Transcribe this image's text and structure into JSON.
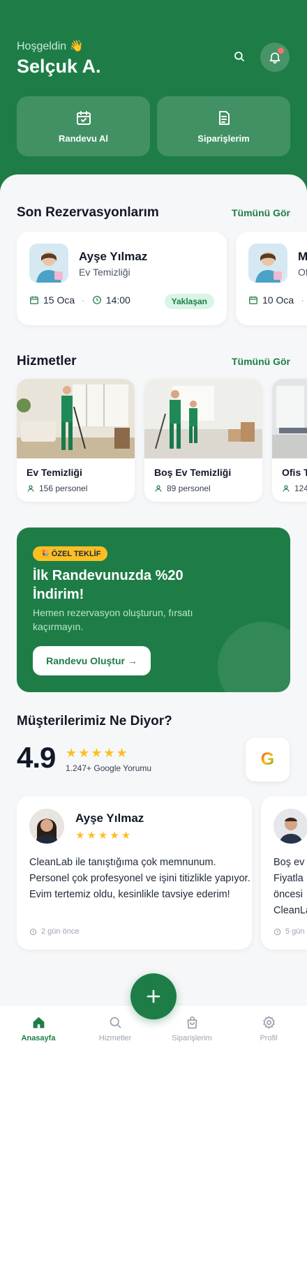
{
  "header": {
    "greeting": "Hoşgeldin 👋",
    "user_name": "Selçuk A.",
    "actions": [
      "search-icon",
      "bell-icon"
    ],
    "quick_actions": [
      {
        "label": "Randevu Al",
        "icon": "calendar-check-icon"
      },
      {
        "label": "Siparişlerim",
        "icon": "receipt-icon"
      }
    ]
  },
  "bookings": {
    "title": "Son Rezervasyonlarım",
    "see_all": "Tümünü Gör",
    "items": [
      {
        "name": "Ayşe Yılmaz",
        "service": "Ev Temizliği",
        "date": "15 Oca",
        "time": "14:00",
        "status": "Yaklaşan"
      },
      {
        "name": "M",
        "service": "Of",
        "date": "10 Oca",
        "time": "",
        "status": ""
      }
    ]
  },
  "services": {
    "title": "Hizmetler",
    "see_all": "Tümünü Gör",
    "items": [
      {
        "name": "Ev Temizliği",
        "count": "156 personel"
      },
      {
        "name": "Boş Ev Temizliği",
        "count": "89 personel"
      },
      {
        "name": "Ofis T",
        "count": "124"
      }
    ]
  },
  "promo": {
    "badge": "🎉 ÖZEL TEKLİF",
    "title": "İlk Randevunuzda %20 İndirim!",
    "subtitle": "Hemen rezervasyon oluşturun, fırsatı kaçırmayın.",
    "cta": "Randevu Oluştur →"
  },
  "reviews": {
    "title": "Müşterilerimiz Ne Diyor?",
    "rating": "4.9",
    "stars": "★★★★★",
    "count": "1.247+ Google Yorumu",
    "google_letter": "G",
    "items": [
      {
        "name": "Ayşe Yılmaz",
        "stars": "★★★★★",
        "text": "CleanLab ile tanıştığıma çok memnunum. Personel çok profesyonel ve işini titizlikle yapıyor. Evim tertemiz oldu, kesinlikle tavsiye ederim!",
        "time": "2 gün önce"
      },
      {
        "name": "",
        "stars": "",
        "text": "Boş ev Fiyatla öncesi CleanLa",
        "time": "5 gün"
      }
    ]
  },
  "nav": {
    "items": [
      {
        "label": "Anasayfa",
        "icon": "home-icon",
        "active": true
      },
      {
        "label": "Hizmetler",
        "icon": "search-icon",
        "active": false
      },
      {
        "label": "Siparişlerim",
        "icon": "shopping-bag-icon",
        "active": false
      },
      {
        "label": "Profil",
        "icon": "gear-icon",
        "active": false
      }
    ],
    "fab_icon": "plus-icon"
  },
  "colors": {
    "brand": "#1e7d47",
    "accent_star": "#fbbf24",
    "status_bg": "#d9f5e5",
    "background": "#f6f7f8"
  }
}
